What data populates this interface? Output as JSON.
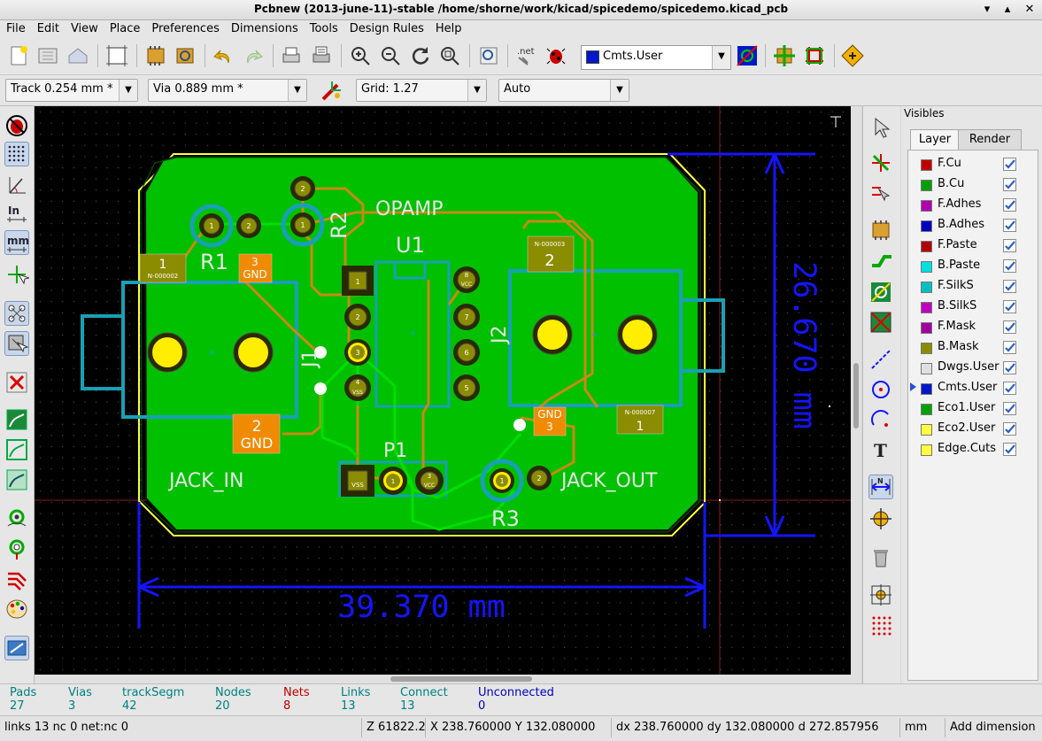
{
  "window": {
    "title": "Pcbnew (2013-june-11)-stable /home/shorne/work/kicad/spicedemo/spicedemo.kicad_pcb",
    "controls": [
      "▾",
      "▴",
      "✕"
    ]
  },
  "menu": [
    "File",
    "Edit",
    "View",
    "Place",
    "Preferences",
    "Dimensions",
    "Tools",
    "Design Rules",
    "Help"
  ],
  "toolbar": {
    "net_label": ".net",
    "active_layer": "Cmts.User"
  },
  "options": {
    "track": "Track 0.254 mm *",
    "via": "Via 0.889 mm *",
    "grid": "Grid: 1.27",
    "zoom": "Auto"
  },
  "board": {
    "units_label_in": "In",
    "units_label_mm": "mm",
    "ref_labels": {
      "R1": "R1",
      "R2": "R2",
      "R3": "R3",
      "U1": "U1",
      "J1": "J1",
      "J2": "J2",
      "P1": "P1"
    },
    "value_labels": {
      "opamp": "OPAMP",
      "jack_in": "JACK_IN",
      "jack_out": "JACK_OUT"
    },
    "dimensions": {
      "width": "39.370 mm",
      "height": "26.670 mm"
    },
    "pad_labels": {
      "r1_pad1": "1",
      "r1_pad2": "2",
      "r2_pad1": "1",
      "r2_pad2": "2",
      "r3_pad1": "1",
      "r3_pad2": "2",
      "u1_p1": "1",
      "u1_p2": "2",
      "u1_p3": "3",
      "u1_p4": "4",
      "u1_p5": "5",
      "u1_p6": "6",
      "u1_p7": "7",
      "u1_p8": "8",
      "u1_vss": "VSS",
      "u1_vcc": "VCC",
      "p1_vss": "VSS",
      "p1_vcc": "VCC",
      "p1_p1": "1",
      "p1_p3": "3",
      "j1_pad1_num": "1",
      "j1_pad1_net": "N-000002",
      "j1_pad3_num": "3",
      "j1_pad3_net": "GND",
      "j1_pad2_num": "2",
      "j1_pad2_net": "GND",
      "j2_pad2_num": "2",
      "j2_pad2_net": "N-000003",
      "j2_pad3_num": "3",
      "j2_pad3_net": "GND",
      "j2_pad1_num": "1",
      "j2_pad1_net": "N-000007"
    }
  },
  "panel": {
    "title": "Visibles",
    "tabs": [
      "Layer",
      "Render"
    ],
    "layers": [
      {
        "name": "F.Cu",
        "color": "#c00000",
        "checked": true
      },
      {
        "name": "B.Cu",
        "color": "#00a000",
        "checked": true
      },
      {
        "name": "F.Adhes",
        "color": "#b000b0",
        "checked": true
      },
      {
        "name": "B.Adhes",
        "color": "#0000c0",
        "checked": true
      },
      {
        "name": "F.Paste",
        "color": "#b00000",
        "checked": true
      },
      {
        "name": "B.Paste",
        "color": "#00e0e0",
        "checked": true
      },
      {
        "name": "F.SilkS",
        "color": "#00c0c0",
        "checked": true
      },
      {
        "name": "B.SilkS",
        "color": "#c000c0",
        "checked": true
      },
      {
        "name": "F.Mask",
        "color": "#a000a0",
        "checked": true
      },
      {
        "name": "B.Mask",
        "color": "#8c8c00",
        "checked": true
      },
      {
        "name": "Dwgs.User",
        "color": "#e0e0e0",
        "checked": true
      },
      {
        "name": "Cmts.User",
        "color": "#0018c8",
        "checked": true
      },
      {
        "name": "Eco1.User",
        "color": "#00a000",
        "checked": true
      },
      {
        "name": "Eco2.User",
        "color": "#ffff40",
        "checked": true
      },
      {
        "name": "Edge.Cuts",
        "color": "#ffff40",
        "checked": true
      }
    ],
    "active_layer": "Cmts.User"
  },
  "messages": [
    {
      "label": "Pads",
      "value": "27",
      "color": "#008080"
    },
    {
      "label": "Vias",
      "value": "3",
      "color": "#008080"
    },
    {
      "label": "trackSegm",
      "value": "42",
      "color": "#008080"
    },
    {
      "label": "Nodes",
      "value": "20",
      "color": "#008080"
    },
    {
      "label": "Nets",
      "value": "8",
      "color": "#c00000"
    },
    {
      "label": "Links",
      "value": "13",
      "color": "#008080"
    },
    {
      "label": "Connect",
      "value": "13",
      "color": "#008080"
    },
    {
      "label": "Unconnected",
      "value": "0",
      "color": "#0000c0"
    }
  ],
  "status": {
    "info": "links 13 nc 0  net:nc 0",
    "zoom": "Z 61822.2",
    "abs": "X 238.760000  Y 132.080000",
    "rel": "dx 238.760000  dy 132.080000  d 272.857956",
    "units": "mm",
    "mode": "Add dimension"
  }
}
